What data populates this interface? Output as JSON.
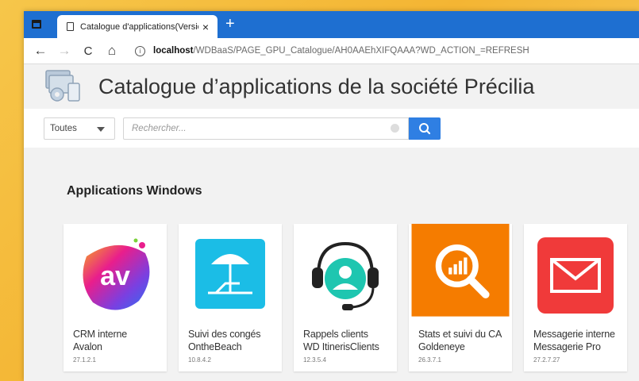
{
  "browser": {
    "tab_title": "Catalogue d'applications(Version",
    "tab_close": "×",
    "new_tab": "+",
    "url_host": "localhost",
    "url_path": "/WDBaaS/PAGE_GPU_Catalogue/AH0AAEhXIFQAAA?WD_ACTION_=REFRESH",
    "buttons": {
      "back": "←",
      "forward": "→",
      "refresh": "C",
      "home": "⌂"
    }
  },
  "header": {
    "title": "Catalogue d’applications de la société Précilia"
  },
  "filter": {
    "selected": "Toutes",
    "search_placeholder": "Rechercher..."
  },
  "section": {
    "title": "Applications Windows"
  },
  "apps": [
    {
      "line1": "CRM interne",
      "line2": "Avalon",
      "version": "27.1.2.1",
      "icon": "avalon-logo-icon",
      "color": "#7b3fe0"
    },
    {
      "line1": "Suivi des congés",
      "line2": "OntheBeach",
      "version": "10.8.4.2",
      "icon": "beach-umbrella-icon",
      "color": "#1bbde6"
    },
    {
      "line1": "Rappels clients",
      "line2": "WD ItinerisClients",
      "version": "12.3.5.4",
      "icon": "headset-user-icon",
      "color": "#1ec6b0"
    },
    {
      "line1": "Stats et suivi du CA",
      "line2": "Goldeneye",
      "version": "26.3.7.1",
      "icon": "magnifier-chart-icon",
      "color": "#f57c00"
    },
    {
      "line1": "Messagerie interne",
      "line2": "Messagerie Pro",
      "version": "27.2.7.27",
      "icon": "envelope-icon",
      "color": "#f03a3a"
    }
  ]
}
